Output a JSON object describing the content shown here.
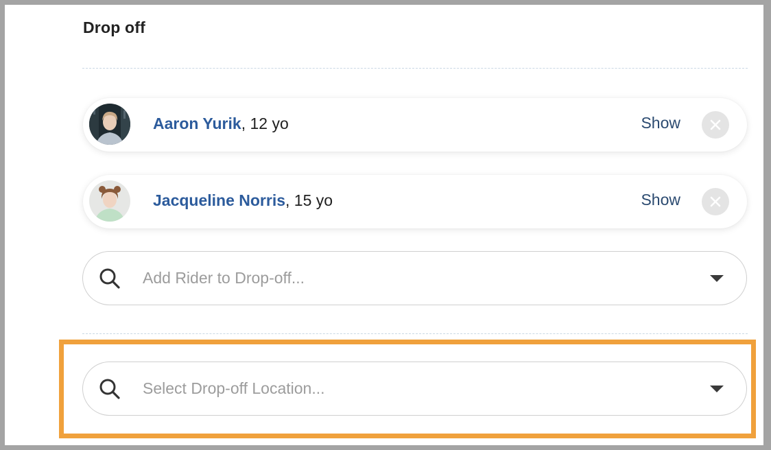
{
  "section": {
    "title": "Drop off"
  },
  "riders": [
    {
      "name": "Aaron Yurik",
      "age": ", 12 yo",
      "show_label": "Show"
    },
    {
      "name": "Jacqueline Norris",
      "age": ", 15 yo",
      "show_label": "Show"
    }
  ],
  "rider_search": {
    "placeholder": "Add Rider to Drop-off..."
  },
  "location_search": {
    "placeholder": "Select Drop-off Location..."
  },
  "colors": {
    "name_link": "#2c5b9c",
    "highlight": "#f0a13c",
    "placeholder": "#9c9c9c"
  }
}
